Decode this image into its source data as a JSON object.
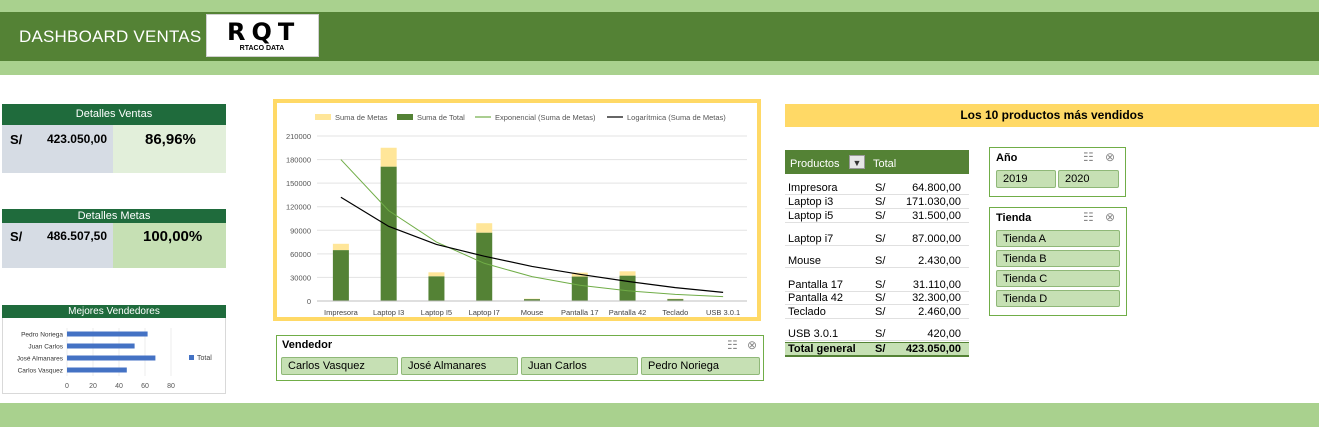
{
  "header": {
    "title": "DASHBOARD VENTAS",
    "logo_text": "RQT",
    "logo_subtitle": "RTACO DATA"
  },
  "ventas": {
    "title": "Detalles Ventas",
    "currency": "S/",
    "amount": "423.050,00",
    "percent": "86,96%"
  },
  "metas": {
    "title": "Detalles Metas",
    "currency": "S/",
    "amount": "486.507,50",
    "percent": "100,00%"
  },
  "vendedores": {
    "title": "Mejores Vendedores",
    "legend": "Total",
    "chart_data": {
      "type": "bar",
      "orientation": "horizontal",
      "categories": [
        "Pedro Noriega",
        "Juan Carlos",
        "José Almanares",
        "Carlos Vasquez"
      ],
      "values": [
        62,
        52,
        68,
        46
      ],
      "xlim": [
        0,
        80
      ],
      "xticks": [
        "0",
        "20",
        "40",
        "60",
        "80"
      ],
      "color": "#4472c4"
    }
  },
  "main_chart": {
    "legend": [
      "Suma de Metas",
      "Suma de Total",
      "Exponencial (Suma de Metas)",
      "Logarítmica (Suma de Metas)"
    ],
    "chart_data": {
      "type": "bar",
      "stacked": true,
      "categories": [
        "Impresora",
        "Laptop I3",
        "Laptop I5",
        "Laptop I7",
        "Mouse",
        "Pantalla 17",
        "Pantalla 42",
        "Teclado",
        "USB 3.0.1"
      ],
      "series": [
        {
          "name": "Suma de Total",
          "values": [
            64800,
            171030,
            31500,
            87000,
            2430,
            31110,
            32300,
            2460,
            420
          ],
          "color": "#548235"
        },
        {
          "name": "Suma de Metas",
          "values": [
            8000,
            24000,
            5000,
            12000,
            500,
            5000,
            5500,
            500,
            200
          ],
          "color": "#ffe699"
        }
      ],
      "trendlines": [
        {
          "name": "Exponencial (Suma de Metas)",
          "values": [
            180000,
            115000,
            75000,
            48000,
            31000,
            20000,
            13000,
            8500,
            5500
          ],
          "color": "#70ad47"
        },
        {
          "name": "Logarítmica (Suma de Metas)",
          "values": [
            132000,
            95000,
            72000,
            57000,
            44000,
            34000,
            25000,
            17000,
            11000
          ],
          "color": "#000000"
        }
      ],
      "yticks": [
        "0",
        "30000",
        "60000",
        "90000",
        "120000",
        "150000",
        "180000",
        "210000"
      ],
      "ylim": [
        0,
        210000
      ],
      "grid": true
    }
  },
  "top10": {
    "title": "Los 10 productos más vendidos",
    "col_products": "Productos",
    "col_total": "Total",
    "rows": [
      {
        "name": "Impresora",
        "cur": "S/",
        "val": "64.800,00"
      },
      {
        "name": "Laptop i3",
        "cur": "S/",
        "val": "171.030,00"
      },
      {
        "name": "Laptop i5",
        "cur": "S/",
        "val": "31.500,00"
      },
      {
        "name": "Laptop i7",
        "cur": "S/",
        "val": "87.000,00"
      },
      {
        "name": "Mouse",
        "cur": "S/",
        "val": "2.430,00"
      },
      {
        "name": "Pantalla 17",
        "cur": "S/",
        "val": "31.110,00"
      },
      {
        "name": "Pantalla 42",
        "cur": "S/",
        "val": "32.300,00"
      },
      {
        "name": "Teclado",
        "cur": "S/",
        "val": "2.460,00"
      },
      {
        "name": "USB 3.0.1",
        "cur": "S/",
        "val": "420,00"
      }
    ],
    "total": {
      "name": "Total general",
      "cur": "S/",
      "val": "423.050,00"
    }
  },
  "slicers": {
    "vendedor": {
      "title": "Vendedor",
      "items": [
        "Carlos Vasquez",
        "José Almanares",
        "Juan Carlos",
        "Pedro Noriega"
      ]
    },
    "anio": {
      "title": "Año",
      "items": [
        "2019",
        "2020"
      ]
    },
    "tienda": {
      "title": "Tienda",
      "items": [
        "Tienda A",
        "Tienda B",
        "Tienda C",
        "Tienda D"
      ]
    }
  },
  "icons": [
    "multi-select-icon",
    "clear-filter-icon",
    "filter-icon"
  ],
  "colors": {
    "dark_green": "#548235",
    "light_green": "#a9d18e",
    "header_card": "#1f6b3c",
    "gold": "#ffd966"
  }
}
